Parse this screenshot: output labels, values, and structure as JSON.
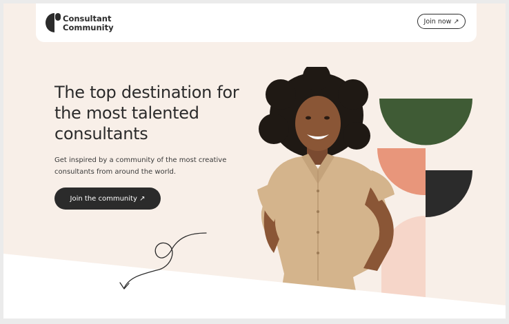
{
  "nav": {
    "logo_line1": "Consultant",
    "logo_line2": "Community",
    "join_now_label": "Join now ↗"
  },
  "hero": {
    "headline": "The top destination for the most talented consultants",
    "subtext": "Get inspired by a community of the most creative consultants from around the world.",
    "cta_label": "Join the community ↗"
  },
  "colors": {
    "page_bg": "#f8efe8",
    "dark": "#2b2b2b",
    "green": "#3f5b35",
    "terracotta": "#e8967b",
    "blush": "#f6d6c9",
    "white": "#ffffff"
  },
  "icons": {
    "logo": "consultant-community-logo-mark",
    "join_now_arrow": "arrow-up-right",
    "doodle": "curly-arrow-down"
  }
}
